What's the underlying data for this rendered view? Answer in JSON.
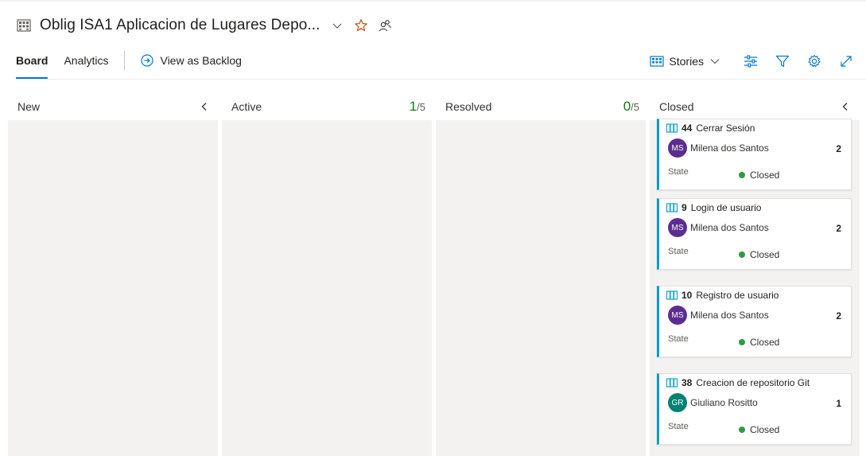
{
  "header": {
    "title": "Oblig ISA1 Aplicacion de Lugares Depo...",
    "icons": [
      "board-grid-icon",
      "chevron-down-icon",
      "star-icon",
      "team-members-icon"
    ]
  },
  "tabs": {
    "items": [
      {
        "label": "Board",
        "active": true
      },
      {
        "label": "Analytics",
        "active": false
      }
    ],
    "backlog_link": "View as Backlog"
  },
  "toolbar": {
    "backlog_level": "Stories",
    "icons": [
      "stories-icon",
      "chevron-down-icon",
      "settings-sliders-icon",
      "filter-icon",
      "gear-icon",
      "expand-icon"
    ]
  },
  "columns": [
    {
      "name": "New"
    },
    {
      "name": "Active",
      "wip_count": "1",
      "wip_limit": "/5"
    },
    {
      "name": "Resolved",
      "wip_count": "0",
      "wip_limit": "/5"
    },
    {
      "name": "Closed"
    }
  ],
  "cards": [
    {
      "id": "44",
      "title": "Cerrar Sesión",
      "assignee": "Milena dos Santos",
      "initials": "MS",
      "avatar_color": "#5c2d91",
      "points": "2",
      "state_label": "State",
      "state": "Closed"
    },
    {
      "id": "9",
      "title": "Login de usuario",
      "assignee": "Milena dos Santos",
      "initials": "MS",
      "avatar_color": "#5c2d91",
      "points": "2",
      "state_label": "State",
      "state": "Closed"
    },
    {
      "id": "10",
      "title": "Registro de usuario",
      "assignee": "Milena dos Santos",
      "initials": "MS",
      "avatar_color": "#5c2d91",
      "points": "2",
      "state_label": "State",
      "state": "Closed"
    },
    {
      "id": "38",
      "title": "Creacion de repositorio Git",
      "assignee": "Giuliano Rositto",
      "initials": "GR",
      "avatar_color": "#008272",
      "points": "1",
      "state_label": "State",
      "state": "Closed"
    }
  ],
  "colors": {
    "accent": "#0078d4",
    "story_bar": "#009ccc",
    "closed_dot": "#339947",
    "wip_count": "#107c10"
  }
}
